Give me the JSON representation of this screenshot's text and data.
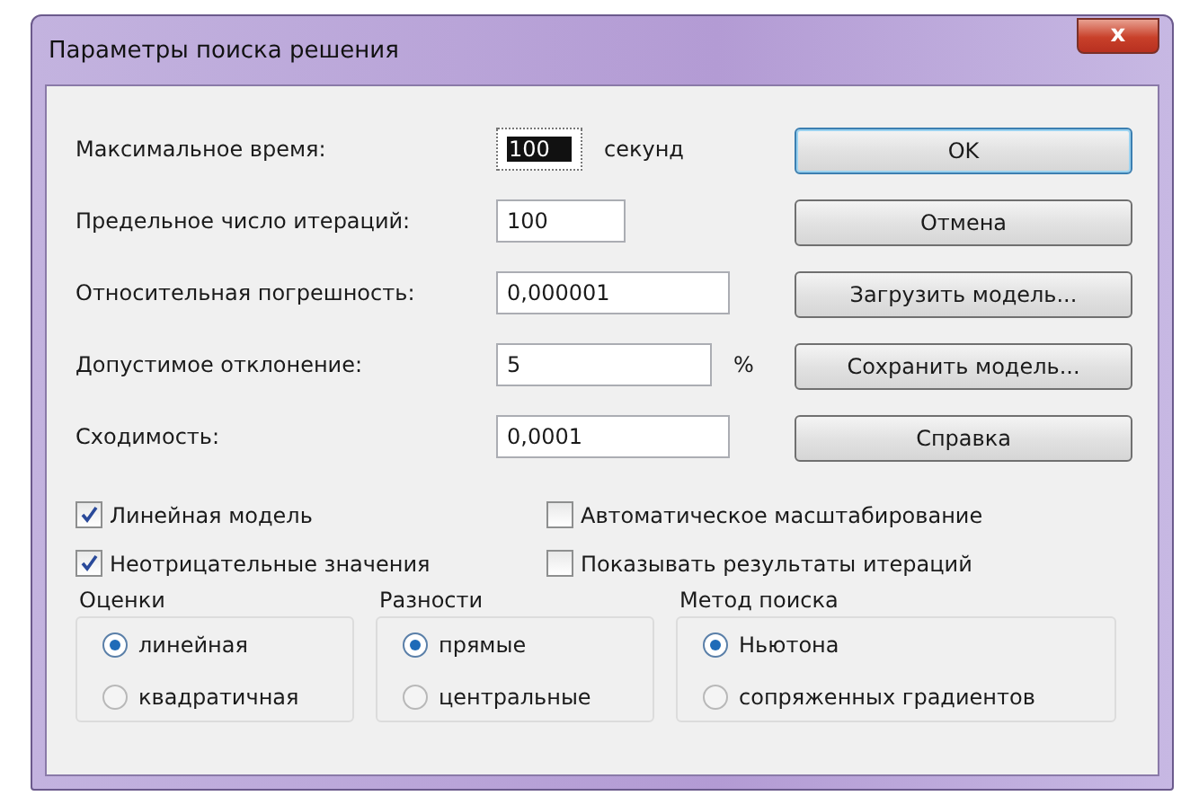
{
  "window": {
    "title": "Параметры поиска решения",
    "close": "x"
  },
  "fields": [
    {
      "label": "Максимальное время:",
      "value": "100",
      "unit": "секунд",
      "highlighted": true
    },
    {
      "label": "Предельное число итераций:",
      "value": "100",
      "highlighted": false
    },
    {
      "label": "Относительная погрешность:",
      "value": "0,000001",
      "highlighted": false
    },
    {
      "label": "Допустимое отклонение:",
      "value": "5",
      "unit": "%",
      "highlighted": false
    },
    {
      "label": "Сходимость:",
      "value": "0,0001",
      "highlighted": false
    }
  ],
  "buttons": [
    {
      "label": "OK",
      "default": true
    },
    {
      "label": "Отмена",
      "default": false
    },
    {
      "label": "Загрузить модель...",
      "default": false
    },
    {
      "label": "Сохранить модель...",
      "default": false
    },
    {
      "label": "Справка",
      "default": false
    }
  ],
  "checkboxes": [
    {
      "label": "Линейная модель",
      "checked": true
    },
    {
      "label": "Автоматическое масштабирование",
      "checked": false
    },
    {
      "label": "Неотрицательные значения",
      "checked": true
    },
    {
      "label": "Показывать результаты итераций",
      "checked": false
    }
  ],
  "groups": [
    {
      "title": "Оценки",
      "options": [
        {
          "label": "линейная",
          "selected": true
        },
        {
          "label": "квадратичная",
          "selected": false
        }
      ]
    },
    {
      "title": "Разности",
      "options": [
        {
          "label": "прямые",
          "selected": true
        },
        {
          "label": "центральные",
          "selected": false
        }
      ]
    },
    {
      "title": "Метод поиска",
      "options": [
        {
          "label": "Ньютона",
          "selected": true
        },
        {
          "label": "сопряженных градиентов",
          "selected": false
        }
      ]
    }
  ]
}
